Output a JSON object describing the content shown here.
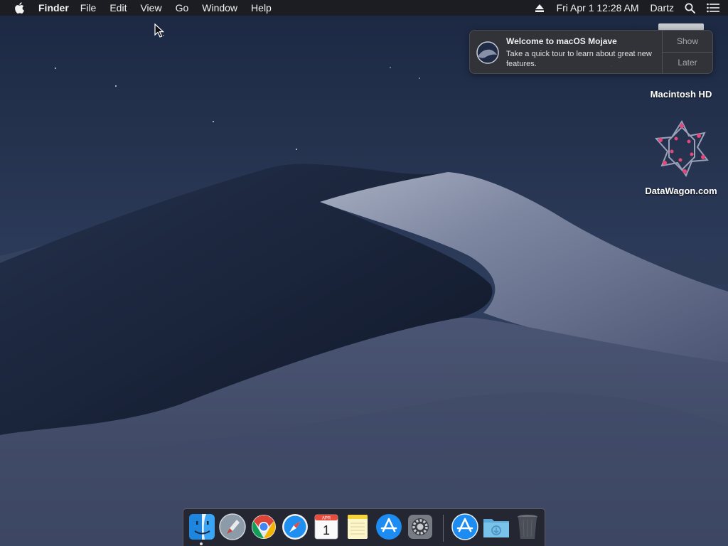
{
  "menubar": {
    "app_name": "Finder",
    "menus": [
      "File",
      "Edit",
      "View",
      "Go",
      "Window",
      "Help"
    ],
    "clock": "Fri Apr 1  12:28 AM",
    "user": "Dartz"
  },
  "notification": {
    "title": "Welcome to macOS Mojave",
    "body": "Take a quick tour to learn about great new features.",
    "actions": {
      "show": "Show",
      "later": "Later"
    }
  },
  "desktop": {
    "icons": [
      {
        "label": "Macintosh HD",
        "icon": "hard-drive-icon"
      },
      {
        "label": "DataWagon.com",
        "icon": "datawagon-icon"
      }
    ]
  },
  "dock": {
    "items": [
      "finder-icon",
      "launchpad-icon",
      "chrome-icon",
      "safari-icon",
      "calendar-icon",
      "notes-icon",
      "app-store-icon",
      "system-preferences-icon",
      "app-store-download-icon",
      "downloads-folder-icon",
      "trash-icon"
    ],
    "calendar": {
      "month": "APR",
      "day": "1"
    }
  },
  "colors": {
    "menubar_bg": "#1c1c20",
    "sky": "#1b2741",
    "dune_light": "#8a93a8"
  }
}
